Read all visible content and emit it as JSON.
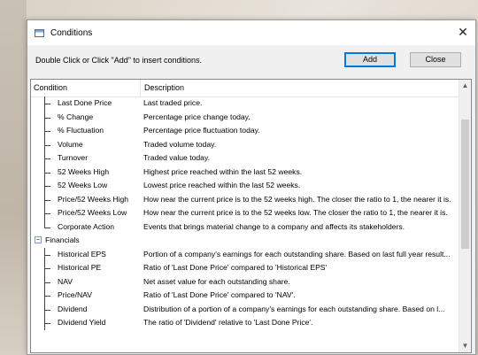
{
  "window": {
    "title": "Conditions",
    "close_glyph": "✕"
  },
  "toolbar": {
    "hint": "Double Click or Click \"Add\" to insert conditions.",
    "add_label": "Add",
    "close_label": "Close"
  },
  "table": {
    "columns": [
      "Condition",
      "Description"
    ],
    "rows": [
      {
        "name": "Last Done Price",
        "desc": "Last traded price."
      },
      {
        "name": "% Change",
        "desc": "Percentage price change today."
      },
      {
        "name": "% Fluctuation",
        "desc": "Percentage price fluctuation today."
      },
      {
        "name": "Volume",
        "desc": "Traded volume today."
      },
      {
        "name": "Turnover",
        "desc": "Traded value today."
      },
      {
        "name": "52 Weeks High",
        "desc": "Highest price reached within the last 52 weeks."
      },
      {
        "name": "52 Weeks Low",
        "desc": "Lowest price reached within the last 52 weeks."
      },
      {
        "name": "Price/52 Weeks High",
        "desc": "How near the current price is to the 52 weeks high. The closer the ratio to 1, the nearer it is."
      },
      {
        "name": "Price/52 Weeks Low",
        "desc": "How near the current price is to the 52 weeks low. The closer the ratio to 1, the nearer it is."
      },
      {
        "name": "Corporate Action",
        "desc": "Events that brings material change to a company and affects its stakeholders."
      }
    ],
    "group2": {
      "name": "Financials",
      "expander": "−",
      "rows": [
        {
          "name": "Historical EPS",
          "desc": "Portion of a company's earnings for each outstanding share. Based on last full year result..."
        },
        {
          "name": "Historical PE",
          "desc": "Ratio of 'Last Done Price' compared to 'Historical EPS'"
        },
        {
          "name": "NAV",
          "desc": "Net asset value for each outstanding share."
        },
        {
          "name": "Price/NAV",
          "desc": "Ratio of 'Last Done Price' compared to 'NAV'."
        },
        {
          "name": "Dividend",
          "desc": "Distribution of a portion of a company's earnings for each outstanding share. Based on l..."
        },
        {
          "name": "Dividend Yield",
          "desc": "The ratio of 'Dividend' relative to 'Last Done Price'."
        }
      ]
    }
  },
  "scrollbar": {
    "up_glyph": "▲",
    "down_glyph": "▼"
  }
}
